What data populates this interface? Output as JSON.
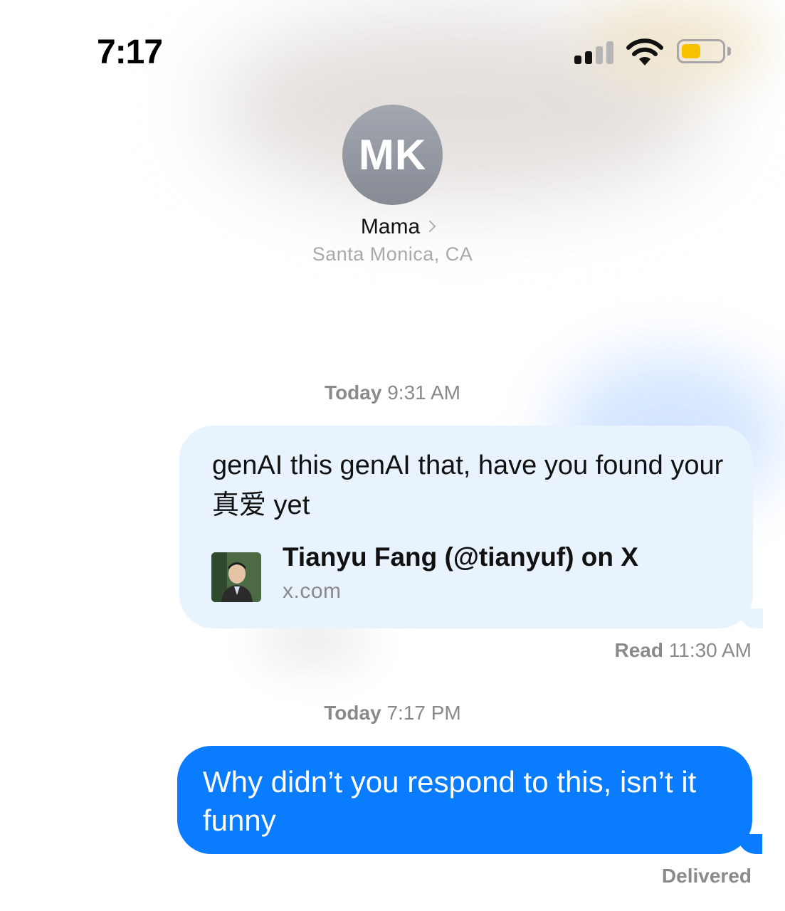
{
  "status_bar": {
    "time": "7:17",
    "icons": [
      "cellular-signal-icon",
      "wifi-icon",
      "battery-icon"
    ]
  },
  "contact": {
    "initials": "MK",
    "name": "Mama",
    "location": "Santa Monica, CA"
  },
  "messages": [
    {
      "timestamp_day": "Today",
      "timestamp_time": "9:31 AM",
      "direction": "incoming",
      "text": "genAI this genAI that, have you found your 真爱 yet",
      "link_preview": {
        "title": "Tianyu Fang (@tianyuf) on X",
        "domain": "x.com"
      },
      "receipt_label": "Read",
      "receipt_time": "11:30 AM"
    },
    {
      "timestamp_day": "Today",
      "timestamp_time": "7:17 PM",
      "direction": "outgoing",
      "text": "Why didn’t you respond to this, isn’t it funny",
      "receipt_label": "Delivered"
    }
  ],
  "colors": {
    "outgoing_bubble": "#0a7cff",
    "incoming_bubble": "#e8f3fd",
    "battery_fill": "#f5c100"
  }
}
